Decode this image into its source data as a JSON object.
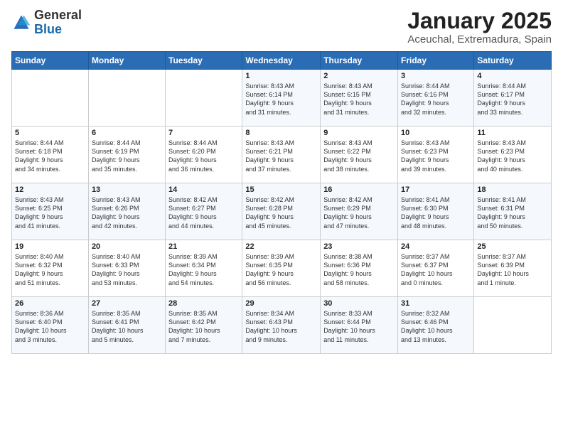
{
  "logo": {
    "general": "General",
    "blue": "Blue"
  },
  "title": "January 2025",
  "subtitle": "Aceuchal, Extremadura, Spain",
  "headers": [
    "Sunday",
    "Monday",
    "Tuesday",
    "Wednesday",
    "Thursday",
    "Friday",
    "Saturday"
  ],
  "weeks": [
    [
      {
        "day": "",
        "lines": []
      },
      {
        "day": "",
        "lines": []
      },
      {
        "day": "",
        "lines": []
      },
      {
        "day": "1",
        "lines": [
          "Sunrise: 8:43 AM",
          "Sunset: 6:14 PM",
          "Daylight: 9 hours",
          "and 31 minutes."
        ]
      },
      {
        "day": "2",
        "lines": [
          "Sunrise: 8:43 AM",
          "Sunset: 6:15 PM",
          "Daylight: 9 hours",
          "and 31 minutes."
        ]
      },
      {
        "day": "3",
        "lines": [
          "Sunrise: 8:44 AM",
          "Sunset: 6:16 PM",
          "Daylight: 9 hours",
          "and 32 minutes."
        ]
      },
      {
        "day": "4",
        "lines": [
          "Sunrise: 8:44 AM",
          "Sunset: 6:17 PM",
          "Daylight: 9 hours",
          "and 33 minutes."
        ]
      }
    ],
    [
      {
        "day": "5",
        "lines": [
          "Sunrise: 8:44 AM",
          "Sunset: 6:18 PM",
          "Daylight: 9 hours",
          "and 34 minutes."
        ]
      },
      {
        "day": "6",
        "lines": [
          "Sunrise: 8:44 AM",
          "Sunset: 6:19 PM",
          "Daylight: 9 hours",
          "and 35 minutes."
        ]
      },
      {
        "day": "7",
        "lines": [
          "Sunrise: 8:44 AM",
          "Sunset: 6:20 PM",
          "Daylight: 9 hours",
          "and 36 minutes."
        ]
      },
      {
        "day": "8",
        "lines": [
          "Sunrise: 8:43 AM",
          "Sunset: 6:21 PM",
          "Daylight: 9 hours",
          "and 37 minutes."
        ]
      },
      {
        "day": "9",
        "lines": [
          "Sunrise: 8:43 AM",
          "Sunset: 6:22 PM",
          "Daylight: 9 hours",
          "and 38 minutes."
        ]
      },
      {
        "day": "10",
        "lines": [
          "Sunrise: 8:43 AM",
          "Sunset: 6:23 PM",
          "Daylight: 9 hours",
          "and 39 minutes."
        ]
      },
      {
        "day": "11",
        "lines": [
          "Sunrise: 8:43 AM",
          "Sunset: 6:23 PM",
          "Daylight: 9 hours",
          "and 40 minutes."
        ]
      }
    ],
    [
      {
        "day": "12",
        "lines": [
          "Sunrise: 8:43 AM",
          "Sunset: 6:25 PM",
          "Daylight: 9 hours",
          "and 41 minutes."
        ]
      },
      {
        "day": "13",
        "lines": [
          "Sunrise: 8:43 AM",
          "Sunset: 6:26 PM",
          "Daylight: 9 hours",
          "and 42 minutes."
        ]
      },
      {
        "day": "14",
        "lines": [
          "Sunrise: 8:42 AM",
          "Sunset: 6:27 PM",
          "Daylight: 9 hours",
          "and 44 minutes."
        ]
      },
      {
        "day": "15",
        "lines": [
          "Sunrise: 8:42 AM",
          "Sunset: 6:28 PM",
          "Daylight: 9 hours",
          "and 45 minutes."
        ]
      },
      {
        "day": "16",
        "lines": [
          "Sunrise: 8:42 AM",
          "Sunset: 6:29 PM",
          "Daylight: 9 hours",
          "and 47 minutes."
        ]
      },
      {
        "day": "17",
        "lines": [
          "Sunrise: 8:41 AM",
          "Sunset: 6:30 PM",
          "Daylight: 9 hours",
          "and 48 minutes."
        ]
      },
      {
        "day": "18",
        "lines": [
          "Sunrise: 8:41 AM",
          "Sunset: 6:31 PM",
          "Daylight: 9 hours",
          "and 50 minutes."
        ]
      }
    ],
    [
      {
        "day": "19",
        "lines": [
          "Sunrise: 8:40 AM",
          "Sunset: 6:32 PM",
          "Daylight: 9 hours",
          "and 51 minutes."
        ]
      },
      {
        "day": "20",
        "lines": [
          "Sunrise: 8:40 AM",
          "Sunset: 6:33 PM",
          "Daylight: 9 hours",
          "and 53 minutes."
        ]
      },
      {
        "day": "21",
        "lines": [
          "Sunrise: 8:39 AM",
          "Sunset: 6:34 PM",
          "Daylight: 9 hours",
          "and 54 minutes."
        ]
      },
      {
        "day": "22",
        "lines": [
          "Sunrise: 8:39 AM",
          "Sunset: 6:35 PM",
          "Daylight: 9 hours",
          "and 56 minutes."
        ]
      },
      {
        "day": "23",
        "lines": [
          "Sunrise: 8:38 AM",
          "Sunset: 6:36 PM",
          "Daylight: 9 hours",
          "and 58 minutes."
        ]
      },
      {
        "day": "24",
        "lines": [
          "Sunrise: 8:37 AM",
          "Sunset: 6:37 PM",
          "Daylight: 10 hours",
          "and 0 minutes."
        ]
      },
      {
        "day": "25",
        "lines": [
          "Sunrise: 8:37 AM",
          "Sunset: 6:39 PM",
          "Daylight: 10 hours",
          "and 1 minute."
        ]
      }
    ],
    [
      {
        "day": "26",
        "lines": [
          "Sunrise: 8:36 AM",
          "Sunset: 6:40 PM",
          "Daylight: 10 hours",
          "and 3 minutes."
        ]
      },
      {
        "day": "27",
        "lines": [
          "Sunrise: 8:35 AM",
          "Sunset: 6:41 PM",
          "Daylight: 10 hours",
          "and 5 minutes."
        ]
      },
      {
        "day": "28",
        "lines": [
          "Sunrise: 8:35 AM",
          "Sunset: 6:42 PM",
          "Daylight: 10 hours",
          "and 7 minutes."
        ]
      },
      {
        "day": "29",
        "lines": [
          "Sunrise: 8:34 AM",
          "Sunset: 6:43 PM",
          "Daylight: 10 hours",
          "and 9 minutes."
        ]
      },
      {
        "day": "30",
        "lines": [
          "Sunrise: 8:33 AM",
          "Sunset: 6:44 PM",
          "Daylight: 10 hours",
          "and 11 minutes."
        ]
      },
      {
        "day": "31",
        "lines": [
          "Sunrise: 8:32 AM",
          "Sunset: 6:46 PM",
          "Daylight: 10 hours",
          "and 13 minutes."
        ]
      },
      {
        "day": "",
        "lines": []
      }
    ]
  ]
}
